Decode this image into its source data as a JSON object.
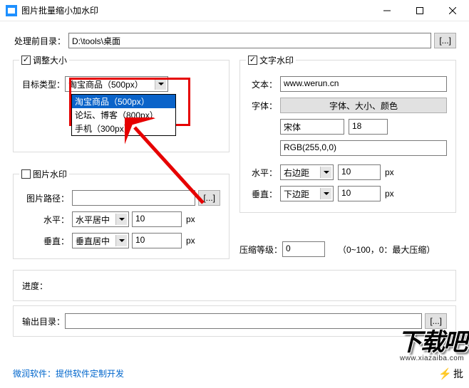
{
  "window": {
    "title": "图片批量缩小加水印"
  },
  "dirRow": {
    "label": "处理前目录：",
    "value": "D:\\tools\\桌面",
    "btn": "[...]"
  },
  "resize": {
    "legend": "调整大小",
    "typeLabel": "目标类型：",
    "selected": "淘宝商品（500px）",
    "options": [
      "淘宝商品（500px）",
      "论坛、博客（800px）",
      "手机（300px）"
    ]
  },
  "imgWm": {
    "legend": "图片水印",
    "pathLabel": "图片路径：",
    "pathBtn": "[...]",
    "hLabel": "水平：",
    "hSel": "水平居中",
    "hVal": "10",
    "hUnit": "px",
    "vLabel": "垂直：",
    "vSel": "垂直居中",
    "vVal": "10",
    "vUnit": "px"
  },
  "textWm": {
    "legend": "文字水印",
    "textLabel": "文本：",
    "textVal": "www.werun.cn",
    "fontLabel": "字体：",
    "fontBtn": "字体、大小、颜色",
    "fontName": "宋体",
    "fontSize": "18",
    "fontColor": "RGB(255,0,0)",
    "hLabel": "水平：",
    "hSel": "右边距",
    "hVal": "10",
    "hUnit": "px",
    "vLabel": "垂直：",
    "vSel": "下边距",
    "vVal": "10",
    "vUnit": "px"
  },
  "compress": {
    "label": "压缩等级：",
    "value": "0",
    "hint": "（0~100，0：最大压缩）"
  },
  "progress": {
    "label": "进度："
  },
  "output": {
    "label": "输出目录：",
    "btn": "[...]"
  },
  "footer": {
    "link": "微润软件：提供软件定制开发",
    "batch": "批"
  },
  "logo": {
    "text": "下载吧",
    "url": "www.xiazaiba.com"
  }
}
